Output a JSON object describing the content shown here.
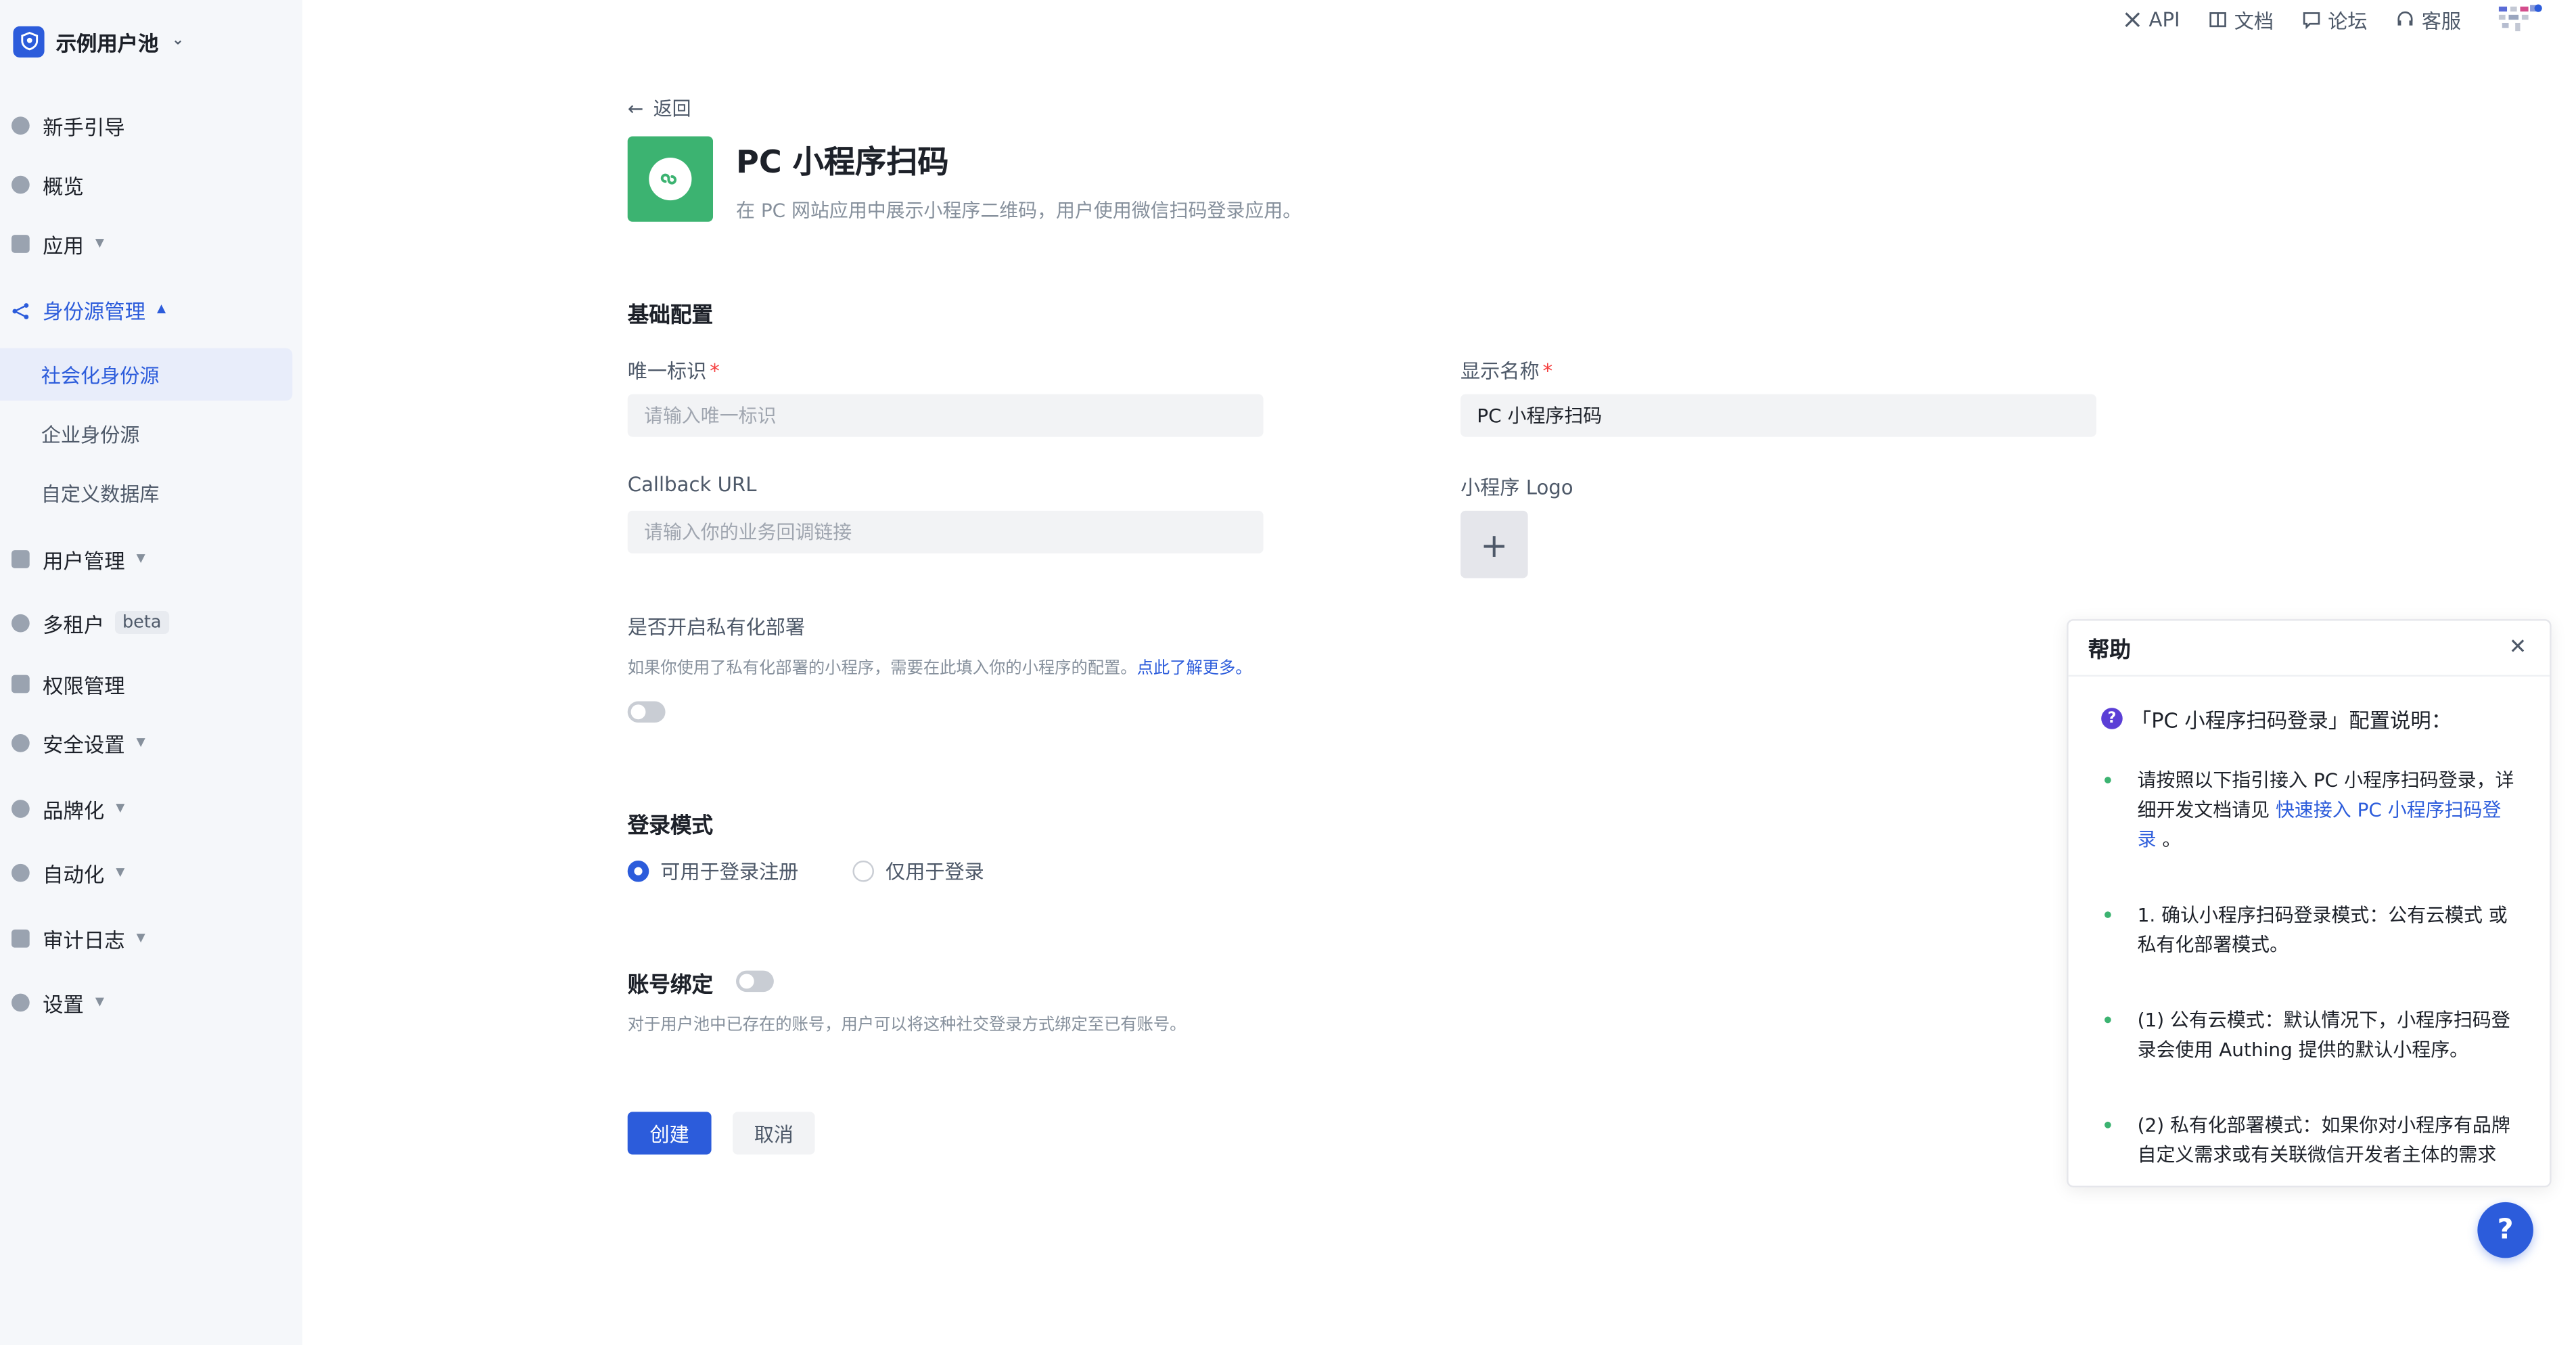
{
  "sidebar": {
    "pool_name": "示例用户池",
    "items": [
      {
        "label": "新手引导"
      },
      {
        "label": "概览"
      },
      {
        "label": "应用"
      },
      {
        "label": "身份源管理"
      },
      {
        "label": "用户管理"
      },
      {
        "label": "多租户",
        "badge": "beta"
      },
      {
        "label": "权限管理"
      },
      {
        "label": "安全设置"
      },
      {
        "label": "品牌化"
      },
      {
        "label": "自动化"
      },
      {
        "label": "审计日志"
      },
      {
        "label": "设置"
      }
    ],
    "sub_items": [
      {
        "label": "社会化身份源"
      },
      {
        "label": "企业身份源"
      },
      {
        "label": "自定义数据库"
      }
    ]
  },
  "topnav": {
    "api": "API",
    "docs": "文档",
    "forum": "论坛",
    "support": "客服"
  },
  "page": {
    "back": "返回",
    "title": "PC 小程序扫码",
    "desc": "在 PC 网站应用中展示小程序二维码，用户使用微信扫码登录应用。"
  },
  "form": {
    "section_basic": "基础配置",
    "unique_id_label": "唯一标识",
    "unique_id_placeholder": "请输入唯一标识",
    "display_name_label": "显示名称",
    "display_name_value": "PC 小程序扫码",
    "callback_label": "Callback URL",
    "callback_placeholder": "请输入你的业务回调链接",
    "logo_label": "小程序 Logo",
    "private_label": "是否开启私有化部署",
    "private_hint": "如果你使用了私有化部署的小程序，需要在此填入你的小程序的配置。",
    "private_link": "点此了解更多。",
    "login_mode_title": "登录模式",
    "mode_option_1": "可用于登录注册",
    "mode_option_2": "仅用于登录",
    "binding_title": "账号绑定",
    "binding_hint": "对于用户池中已存在的账号，用户可以将这种社交登录方式绑定至已有账号。",
    "create": "创建",
    "cancel": "取消"
  },
  "help": {
    "title": "帮助",
    "question": "「PC 小程序扫码登录」配置说明：",
    "item1_text": "请按照以下指引接入 PC 小程序扫码登录，详细开发文档请见 ",
    "item1_link": "快速接入 PC 小程序扫码登录",
    "item1_end": " 。",
    "item2": "1. 确认小程序扫码登录模式：公有云模式 或 私有化部署模式。",
    "item3": "(1) 公有云模式：默认情况下，小程序扫码登录会使用 Authing 提供的默认小程序。",
    "item4": "(2) 私有化部署模式：如果你对小程序有品牌自定义需求或有关联微信开发者主体的需求"
  },
  "fab": "?"
}
